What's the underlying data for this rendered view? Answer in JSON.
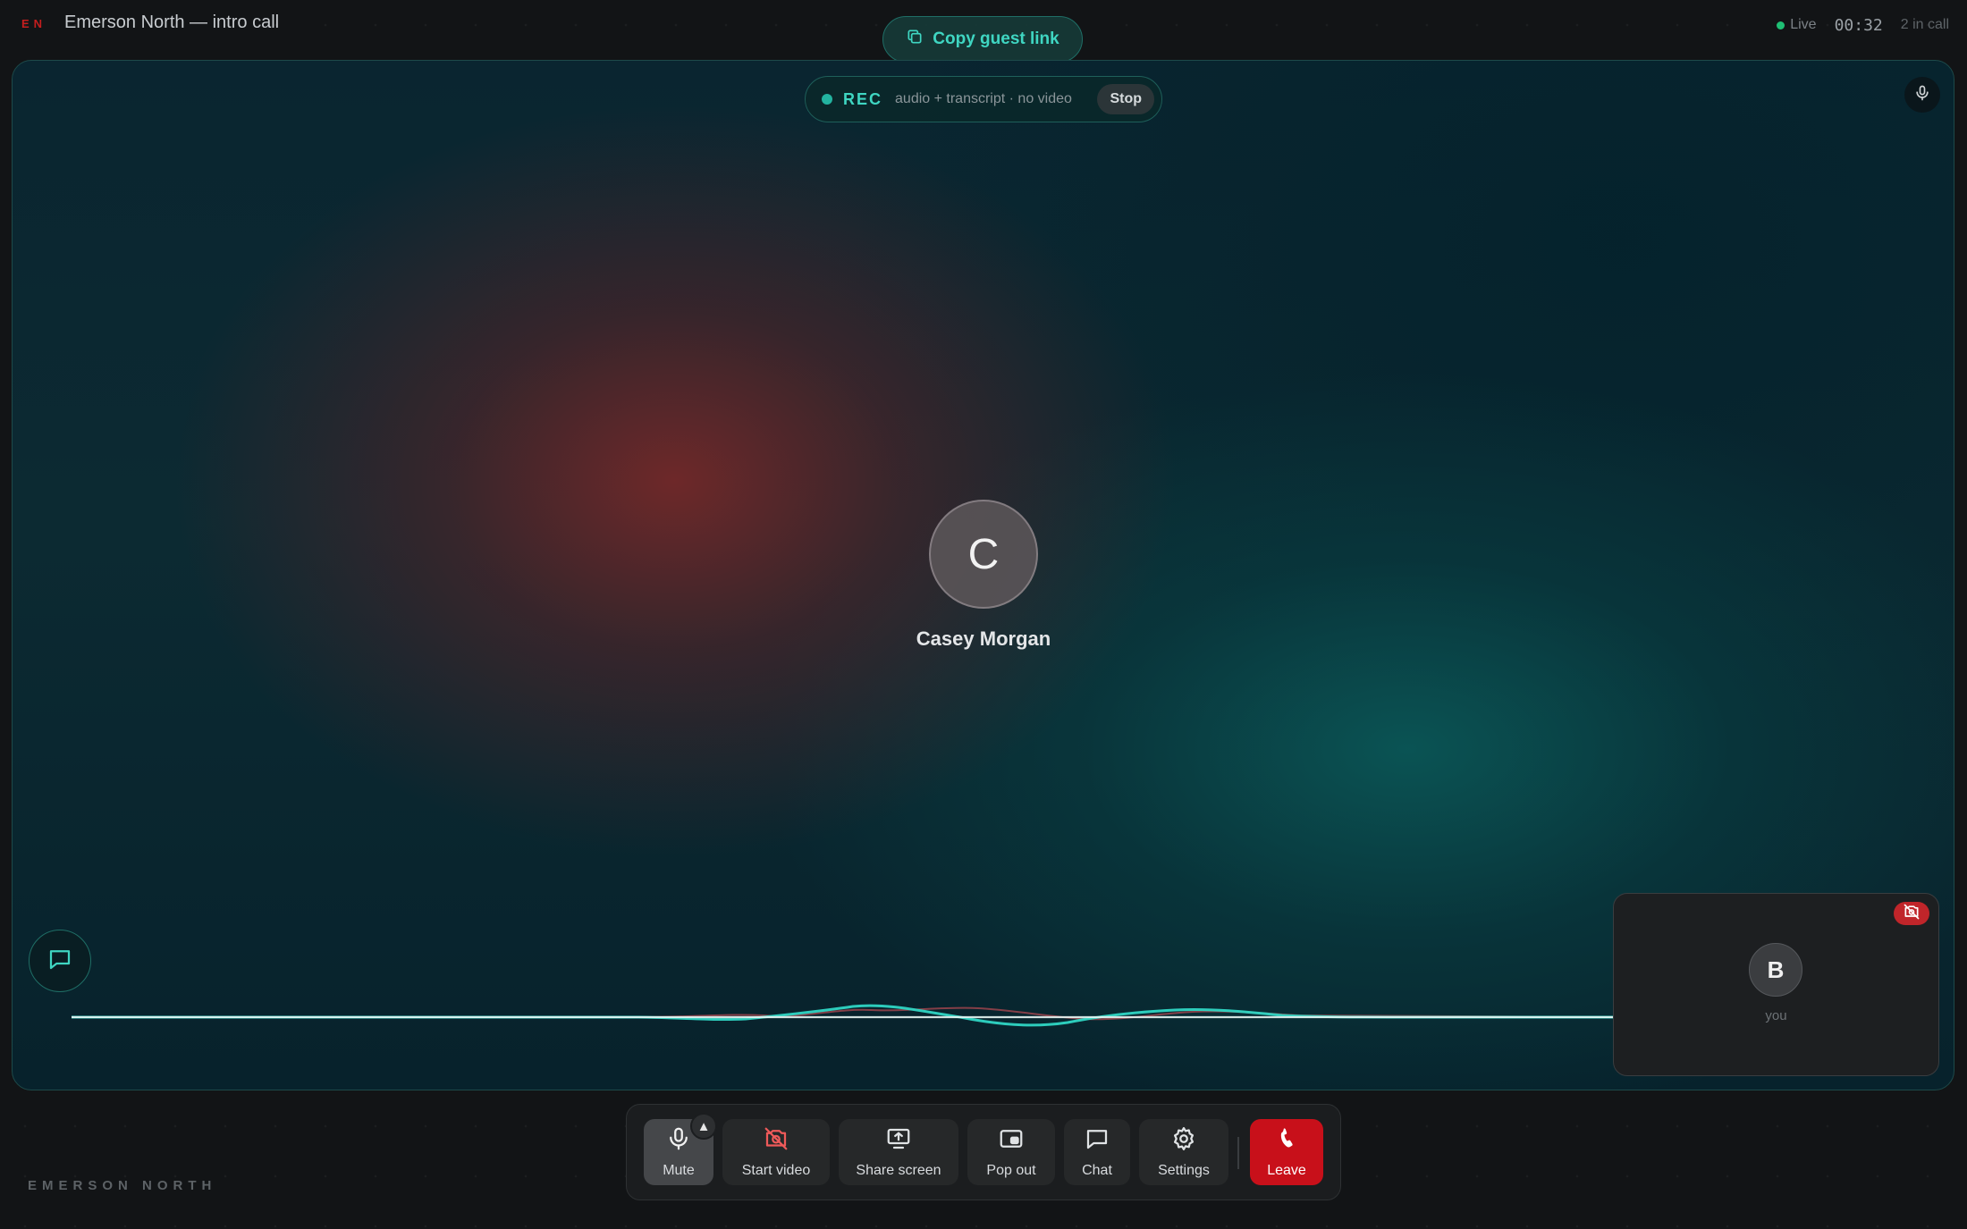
{
  "topbar": {
    "brand_mark": "EN",
    "title": "Emerson North — intro call",
    "copy_link_label": "Copy guest link",
    "live_label": "Live",
    "timer": "00:32",
    "participants_label": "2 in call"
  },
  "recording": {
    "label": "REC",
    "description": "audio + transcript · no video",
    "stop_label": "Stop"
  },
  "remote_participant": {
    "initial": "C",
    "name": "Casey Morgan"
  },
  "self_view": {
    "initial": "B",
    "label": "you"
  },
  "controls": {
    "mute": "Mute",
    "start_video": "Start video",
    "share_screen": "Share screen",
    "pop_out": "Pop out",
    "chat": "Chat",
    "settings": "Settings",
    "leave": "Leave",
    "caret": "▲"
  },
  "footer": {
    "brand": "EMERSON NORTH"
  },
  "colors": {
    "accent": "#3fd6c2",
    "live": "#1fbf74",
    "danger": "#c8101a",
    "brand_red": "#c41e1e"
  }
}
